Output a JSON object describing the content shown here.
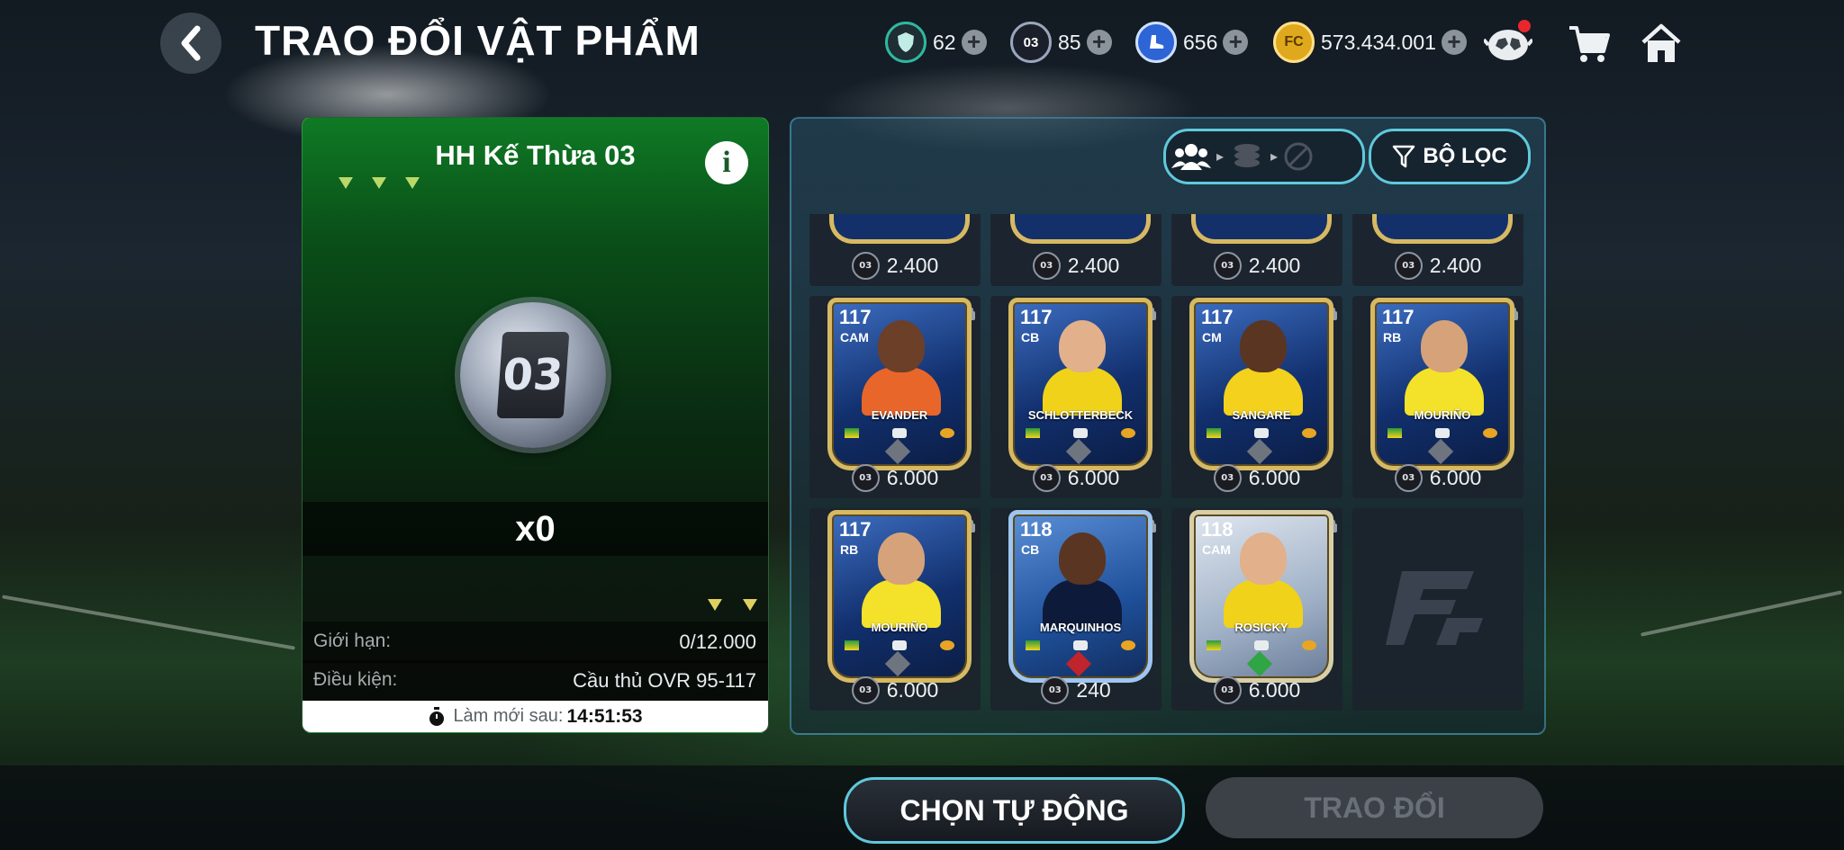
{
  "header": {
    "title": "TRAO ĐỔI VẬT PHẨM",
    "currencies": [
      {
        "icon": "shield-token-icon",
        "value": "62"
      },
      {
        "icon": "03-token-icon",
        "value": "85",
        "token_text": "03"
      },
      {
        "icon": "boot-token-icon",
        "value": "656"
      },
      {
        "icon": "fc-coin-icon",
        "value": "573.434.001"
      }
    ],
    "colors": {
      "shield": "#2fb8a0",
      "token": "#2b3a66",
      "boot": "#2d64d6",
      "coin": "#e0a81c"
    }
  },
  "left_panel": {
    "title": "HH Kế Thừa 03",
    "token_label": "03",
    "quantity": "x0",
    "limit_label": "Giới hạn:",
    "limit_value": "0/12.000",
    "condition_label": "Điều kiện:",
    "condition_value": "Cầu thủ OVR 95-117",
    "refresh_label": "Làm mới sau:",
    "refresh_time": "14:51:53"
  },
  "right_panel": {
    "filter_label": "BỘ LỌC",
    "token_text": "03",
    "top_row_prices": [
      "2.400",
      "2.400",
      "2.400",
      "2.400"
    ],
    "cards": [
      {
        "ovr": "117",
        "pos": "CAM",
        "name": "EVANDER",
        "price": "6.000",
        "kit": "#e8662a",
        "skin": "#6b3f28",
        "variant": "gold",
        "gem": "#6f757e"
      },
      {
        "ovr": "117",
        "pos": "CB",
        "name": "SCHLOTTERBECK",
        "price": "6.000",
        "kit": "#f1d21a",
        "skin": "#e2b08a",
        "variant": "gold",
        "gem": "#6f757e"
      },
      {
        "ovr": "117",
        "pos": "CM",
        "name": "SANGARE",
        "price": "6.000",
        "kit": "#f3d11d",
        "skin": "#5a3522",
        "variant": "gold",
        "gem": "#6f757e"
      },
      {
        "ovr": "117",
        "pos": "RB",
        "name": "MOURIÑO",
        "price": "6.000",
        "kit": "#f4e12a",
        "skin": "#d6a27a",
        "variant": "gold",
        "gem": "#6f757e"
      },
      {
        "ovr": "117",
        "pos": "RB",
        "name": "MOURIÑO",
        "price": "6.000",
        "kit": "#f4e12a",
        "skin": "#d6a27a",
        "variant": "gold",
        "gem": "#6f757e"
      },
      {
        "ovr": "118",
        "pos": "CB",
        "name": "MARQUINHOS",
        "price": "240",
        "kit": "#0d1a3a",
        "skin": "#5a3522",
        "variant": "ucl",
        "gem": "#c0242c"
      },
      {
        "ovr": "118",
        "pos": "CAM",
        "name": "ROSICKY",
        "price": "6.000",
        "kit": "#f1d21a",
        "skin": "#e2b08a",
        "variant": "silver",
        "gem": "#2fa544"
      }
    ]
  },
  "footer": {
    "auto_label": "CHỌN TỰ ĐỘNG",
    "trade_label": "TRAO ĐỔI"
  }
}
